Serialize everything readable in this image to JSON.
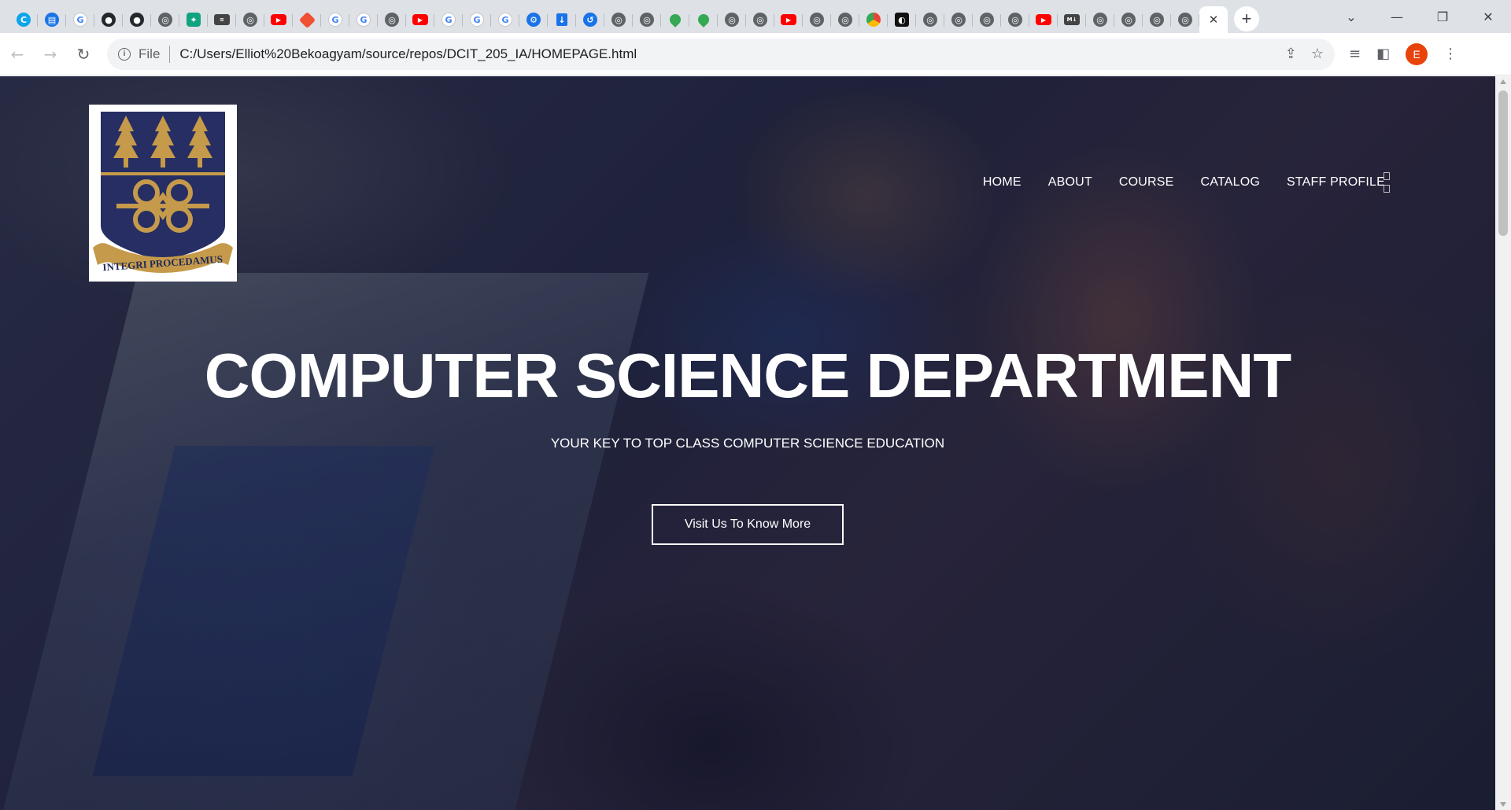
{
  "browser": {
    "tabs": [
      {
        "icon": "c-logo-icon",
        "glyph": "C",
        "kind": "cyan"
      },
      {
        "icon": "printer-icon",
        "glyph": "▤",
        "kind": "blue"
      },
      {
        "icon": "google-icon",
        "glyph": "G",
        "kind": "google"
      },
      {
        "icon": "github-icon",
        "glyph": "●",
        "kind": "gh"
      },
      {
        "icon": "github-icon",
        "glyph": "●",
        "kind": "gh"
      },
      {
        "icon": "globe-icon",
        "glyph": "◎",
        "kind": "globe"
      },
      {
        "icon": "chatgpt-icon",
        "glyph": "✦",
        "kind": "gpt"
      },
      {
        "icon": "page-icon",
        "glyph": "≡",
        "kind": "md"
      },
      {
        "icon": "globe-icon",
        "glyph": "◎",
        "kind": "globe"
      },
      {
        "icon": "youtube-icon",
        "glyph": "▶",
        "kind": "yt"
      },
      {
        "icon": "git-icon",
        "glyph": "",
        "kind": "git"
      },
      {
        "icon": "google-icon",
        "glyph": "G",
        "kind": "google"
      },
      {
        "icon": "google-icon",
        "glyph": "G",
        "kind": "google"
      },
      {
        "icon": "globe-icon",
        "glyph": "◎",
        "kind": "globe"
      },
      {
        "icon": "youtube-icon",
        "glyph": "▶",
        "kind": "yt"
      },
      {
        "icon": "google-icon",
        "glyph": "G",
        "kind": "google"
      },
      {
        "icon": "google-icon",
        "glyph": "G",
        "kind": "google"
      },
      {
        "icon": "google-icon",
        "glyph": "G",
        "kind": "google"
      },
      {
        "icon": "settings-icon",
        "glyph": "⚙",
        "kind": "blue"
      },
      {
        "icon": "download-icon",
        "glyph": "↓",
        "kind": "dl"
      },
      {
        "icon": "history-icon",
        "glyph": "↺",
        "kind": "blue"
      },
      {
        "icon": "globe-icon",
        "glyph": "◎",
        "kind": "globe"
      },
      {
        "icon": "globe-icon",
        "glyph": "◎",
        "kind": "globe"
      },
      {
        "icon": "maps-icon",
        "glyph": "",
        "kind": "map"
      },
      {
        "icon": "maps-icon",
        "glyph": "",
        "kind": "map"
      },
      {
        "icon": "globe-icon",
        "glyph": "◎",
        "kind": "globe"
      },
      {
        "icon": "globe-icon",
        "glyph": "◎",
        "kind": "globe"
      },
      {
        "icon": "youtube-icon",
        "glyph": "▶",
        "kind": "yt"
      },
      {
        "icon": "globe-icon",
        "glyph": "◎",
        "kind": "globe"
      },
      {
        "icon": "globe-icon",
        "glyph": "◎",
        "kind": "globe"
      },
      {
        "icon": "chrome-icon",
        "glyph": "",
        "kind": "chrome"
      },
      {
        "icon": "dark-app-icon",
        "glyph": "◐",
        "kind": "dark"
      },
      {
        "icon": "globe-icon",
        "glyph": "◎",
        "kind": "globe"
      },
      {
        "icon": "globe-icon",
        "glyph": "◎",
        "kind": "globe"
      },
      {
        "icon": "globe-icon",
        "glyph": "◎",
        "kind": "globe"
      },
      {
        "icon": "globe-icon",
        "glyph": "◎",
        "kind": "globe"
      },
      {
        "icon": "youtube-icon",
        "glyph": "▶",
        "kind": "yt"
      },
      {
        "icon": "markdown-icon",
        "glyph": "M↓",
        "kind": "md"
      },
      {
        "icon": "globe-icon",
        "glyph": "◎",
        "kind": "globe"
      },
      {
        "icon": "globe-icon",
        "glyph": "◎",
        "kind": "globe"
      },
      {
        "icon": "globe-icon",
        "glyph": "◎",
        "kind": "globe"
      },
      {
        "icon": "globe-icon",
        "glyph": "◎",
        "kind": "globe"
      }
    ],
    "active_tab_close": "✕",
    "new_tab": "+",
    "window_controls": {
      "tab_search": "⌄",
      "minimize": "—",
      "restore": "❐",
      "close": "✕"
    },
    "nav": {
      "back": "←",
      "forward": "→",
      "reload": "↻"
    },
    "address": {
      "info_glyph": "i",
      "scheme_label": "File",
      "url": "C:/Users/Elliot%20Bekoagyam/source/repos/DCIT_205_IA/HOMEPAGE.html"
    },
    "omnibox_actions": {
      "share": "⇪",
      "bookmark": "☆"
    },
    "toolbar_actions": {
      "reading_list": "≡",
      "side_panel": "◧",
      "profile_initial": "E",
      "menu": "⋮"
    }
  },
  "page": {
    "logo": {
      "motto": "INTEGRI PROCEDAMUS"
    },
    "nav": [
      "HOME",
      "ABOUT",
      "COURSE",
      "CATALOG",
      "STAFF PROFILE"
    ],
    "hero": {
      "title": "COMPUTER SCIENCE DEPARTMENT",
      "subtitle": "YOUR KEY TO TOP CLASS COMPUTER SCIENCE EDUCATION",
      "button": "Visit Us To Know More"
    }
  },
  "colors": {
    "crest_navy": "#262e63",
    "crest_gold": "#c59a4a",
    "profile": "#e8430a"
  }
}
